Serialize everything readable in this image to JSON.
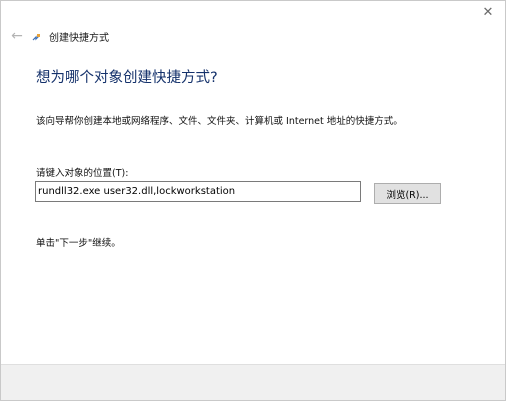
{
  "window": {
    "close_glyph": "✕",
    "back_glyph": "←",
    "title": "创建快捷方式"
  },
  "page": {
    "heading": "想为哪个对象创建快捷方式?",
    "description": "该向导帮你创建本地或网络程序、文件、文件夹、计算机或 Internet 地址的快捷方式。",
    "field_label": "请键入对象的位置(T):",
    "field_value": "rundll32.exe user32.dll,lockworkstation",
    "browse_label": "浏览(R)...",
    "hint": "单击\"下一步\"继续。"
  },
  "colors": {
    "heading": "#14316b",
    "footer_bg": "#f0f0f0",
    "button_bg": "#e1e1e1"
  }
}
